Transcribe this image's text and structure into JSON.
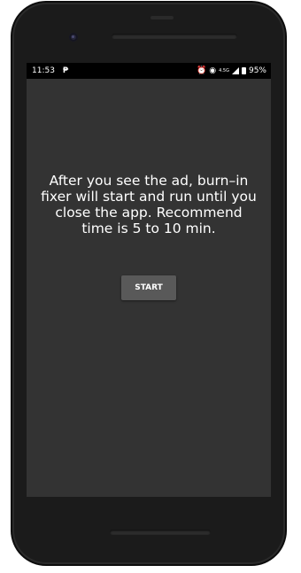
{
  "status_bar": {
    "time": "11:53",
    "notification_icon": "p-icon",
    "network_label": "4.5G",
    "battery_percent": "95%",
    "icons": [
      "alarm-icon",
      "hotspot-icon",
      "signal-icon",
      "battery-icon"
    ]
  },
  "main": {
    "message": "After you see the ad, burn–in fixer will start and run until you close the app. Recommend time is 5 to 10 min.",
    "start_label": "START"
  },
  "colors": {
    "screen_background": "#333333",
    "button_background": "#595959",
    "text": "#ffffff",
    "phone_frame": "#1b1b1b"
  }
}
